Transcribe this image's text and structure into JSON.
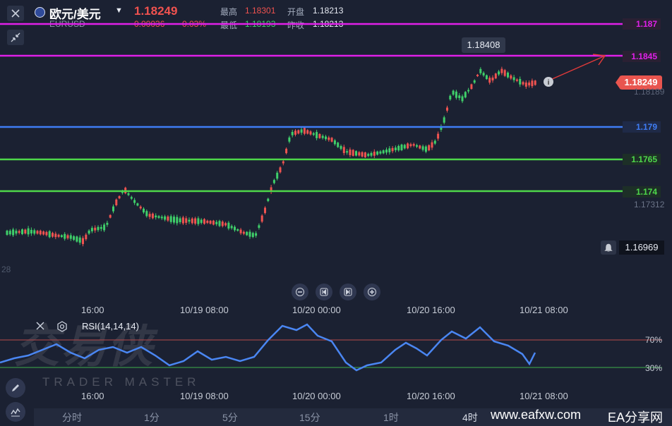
{
  "header": {
    "title": "欧元/美元",
    "symbol": "EURUSD",
    "price": "1.18249",
    "change": "0.00036",
    "change_pct": "0.03%",
    "stats": {
      "high_label": "最高",
      "high": "1.18301",
      "open_label": "开盘",
      "open": "1.18213",
      "low_label": "最低",
      "low": "1.18193",
      "prev_label": "昨收",
      "prev": "1.18213"
    }
  },
  "levels": [
    {
      "label": "1.187",
      "color": "#e020e8",
      "price": 1.187
    },
    {
      "label": "1.1845",
      "color": "#e020e8",
      "price": 1.1845
    },
    {
      "label": "1.179",
      "color": "#3f7df5",
      "price": 1.179
    },
    {
      "label": "1.1765",
      "color": "#4ed84a",
      "price": 1.1765
    },
    {
      "label": "1.174",
      "color": "#4ed84a",
      "price": 1.174
    }
  ],
  "price_axis": {
    "current_tag": "1.18249",
    "ghost_1": "1.18189",
    "ghost_2": "1.17312",
    "alert_price": "1.16969"
  },
  "tooltip_high": "1.18408",
  "left_edge_label": "28",
  "controls": [
    "zoom-out",
    "prev",
    "next",
    "zoom-in"
  ],
  "time_axis_main": [
    "16:00",
    "10/19 08:00",
    "10/20 00:00",
    "10/20 16:00",
    "10/21 08:00"
  ],
  "time_axis_sub": [
    "16:00",
    "10/19 08:00",
    "10/20 00:00",
    "10/20 16:00",
    "10/21 08:00"
  ],
  "rsi": {
    "label": "RSI(14,14,14)",
    "upper_label": "70%",
    "lower_label": "30%",
    "upper": 70,
    "lower": 30,
    "color": "#4a86f2"
  },
  "timeframes": [
    "分时",
    "1分",
    "5分",
    "15分",
    "1时",
    "4时"
  ],
  "watermark": {
    "main": "交易侠",
    "sub": "TRADER MASTER"
  },
  "site": {
    "domain": "www.eafxw.com",
    "name": "EA分享网"
  },
  "colors": {
    "up": "#ef5350",
    "down": "#3fcf6a",
    "bg": "#1b2132"
  }
}
